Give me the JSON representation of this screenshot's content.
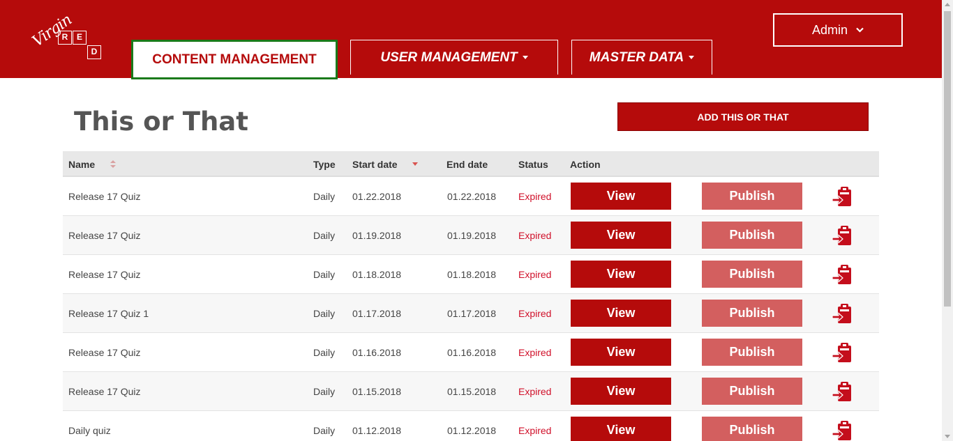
{
  "header": {
    "logo": {
      "script": "Virgin",
      "letters": [
        "R",
        "E",
        "D"
      ]
    },
    "nav": {
      "content_management": "CONTENT MANAGEMENT",
      "user_management": "USER MANAGEMENT",
      "master_data": "MASTER DATA"
    },
    "admin_label": "Admin"
  },
  "page": {
    "title": "This or That",
    "add_button": "ADD THIS OR THAT"
  },
  "table": {
    "columns": {
      "name": "Name",
      "type": "Type",
      "start_date": "Start date",
      "end_date": "End date",
      "status": "Status",
      "action": "Action"
    },
    "rows": [
      {
        "name": "Release 17 Quiz",
        "type": "Daily",
        "start": "01.22.2018",
        "end": "01.22.2018",
        "status": "Expired",
        "view": "View",
        "publish": "Publish"
      },
      {
        "name": "Release 17 Quiz",
        "type": "Daily",
        "start": "01.19.2018",
        "end": "01.19.2018",
        "status": "Expired",
        "view": "View",
        "publish": "Publish"
      },
      {
        "name": "Release 17 Quiz",
        "type": "Daily",
        "start": "01.18.2018",
        "end": "01.18.2018",
        "status": "Expired",
        "view": "View",
        "publish": "Publish"
      },
      {
        "name": "Release 17 Quiz 1",
        "type": "Daily",
        "start": "01.17.2018",
        "end": "01.17.2018",
        "status": "Expired",
        "view": "View",
        "publish": "Publish"
      },
      {
        "name": "Release 17 Quiz",
        "type": "Daily",
        "start": "01.16.2018",
        "end": "01.16.2018",
        "status": "Expired",
        "view": "View",
        "publish": "Publish"
      },
      {
        "name": "Release 17 Quiz",
        "type": "Daily",
        "start": "01.15.2018",
        "end": "01.15.2018",
        "status": "Expired",
        "view": "View",
        "publish": "Publish"
      },
      {
        "name": "Daily quiz",
        "type": "Daily",
        "start": "01.12.2018",
        "end": "01.12.2018",
        "status": "Expired",
        "view": "View",
        "publish": "Publish"
      }
    ]
  },
  "colors": {
    "brand": "#b50b0b",
    "publish": "#d35f5f",
    "status_expired": "#d0102a",
    "active_border": "#1a7a1a"
  },
  "icons": {
    "row_action": "clipboard-export-icon",
    "sort": "sort-icon",
    "dropdown": "chevron-down-icon"
  }
}
